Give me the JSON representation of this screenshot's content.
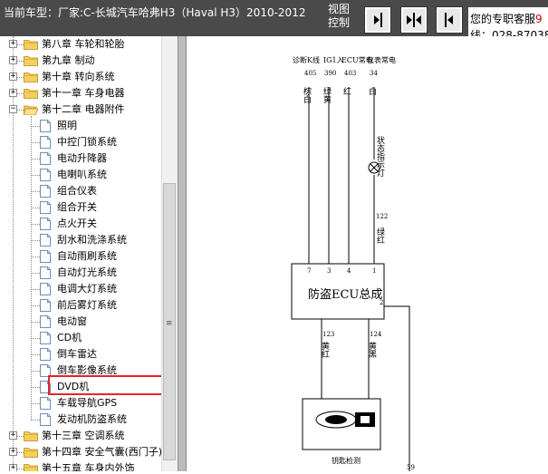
{
  "header": {
    "car_label": "当前车型：厂家:C-长城汽车哈弗H3（Haval H3）2010-2012",
    "view_label": "视图控制",
    "service_line1": "您的专职客服",
    "service_accent": "9",
    "service_line2": "线：028-87038"
  },
  "tree": {
    "items": [
      {
        "label": "第八章 车轮和轮胎",
        "kind": "folder"
      },
      {
        "label": "第九章 制动",
        "kind": "folder"
      },
      {
        "label": "第十章 转向系统",
        "kind": "folder"
      },
      {
        "label": "第十一章 车身电器",
        "kind": "folder"
      },
      {
        "label": "第十二章 电器附件",
        "kind": "folder-open"
      },
      {
        "label": "照明",
        "kind": "doc"
      },
      {
        "label": "中控门锁系统",
        "kind": "doc"
      },
      {
        "label": "电动升降器",
        "kind": "doc"
      },
      {
        "label": "电喇叭系统",
        "kind": "doc"
      },
      {
        "label": "组合仪表",
        "kind": "doc"
      },
      {
        "label": "组合开关",
        "kind": "doc"
      },
      {
        "label": "点火开关",
        "kind": "doc"
      },
      {
        "label": "刮水和洗涤系统",
        "kind": "doc"
      },
      {
        "label": "自动雨刷系统",
        "kind": "doc"
      },
      {
        "label": "自动灯光系统",
        "kind": "doc"
      },
      {
        "label": "电调大灯系统",
        "kind": "doc"
      },
      {
        "label": "前后雾灯系统",
        "kind": "doc"
      },
      {
        "label": "电动窗",
        "kind": "doc"
      },
      {
        "label": "CD机",
        "kind": "doc"
      },
      {
        "label": "倒车雷达",
        "kind": "doc"
      },
      {
        "label": "倒车影像系统",
        "kind": "doc"
      },
      {
        "label": "DVD机",
        "kind": "doc"
      },
      {
        "label": "车载导航GPS",
        "kind": "doc"
      },
      {
        "label": "发动机防盗系统",
        "kind": "doc-selected"
      },
      {
        "label": "第十三章 空调系统",
        "kind": "folder"
      },
      {
        "label": "第十四章 安全气囊(西门子)",
        "kind": "folder"
      },
      {
        "label": "第十五章 车身内外饰",
        "kind": "folder"
      }
    ]
  },
  "diagram": {
    "col_headers": [
      "诊断K线",
      "IG1入",
      "ECU常电",
      "仪表常电"
    ],
    "wire_ids": [
      "405",
      "390",
      "403",
      "34"
    ],
    "wire_colors": [
      "棕白",
      "绿黄",
      "红",
      "白"
    ],
    "lamp_label": "状态指示灯",
    "lamp_wire_id": "122",
    "lamp_wire_color": "绿红",
    "ecu_pins": [
      "7",
      "3",
      "4",
      "1"
    ],
    "ecu_title": "防盗ECU总成",
    "ecu_pin_right": "2",
    "bottom_wire_ids": [
      "123",
      "124"
    ],
    "bottom_wire_colors": [
      "黄红",
      "黄黑"
    ],
    "key_label": "钥匙检测",
    "pin_59": "59"
  }
}
